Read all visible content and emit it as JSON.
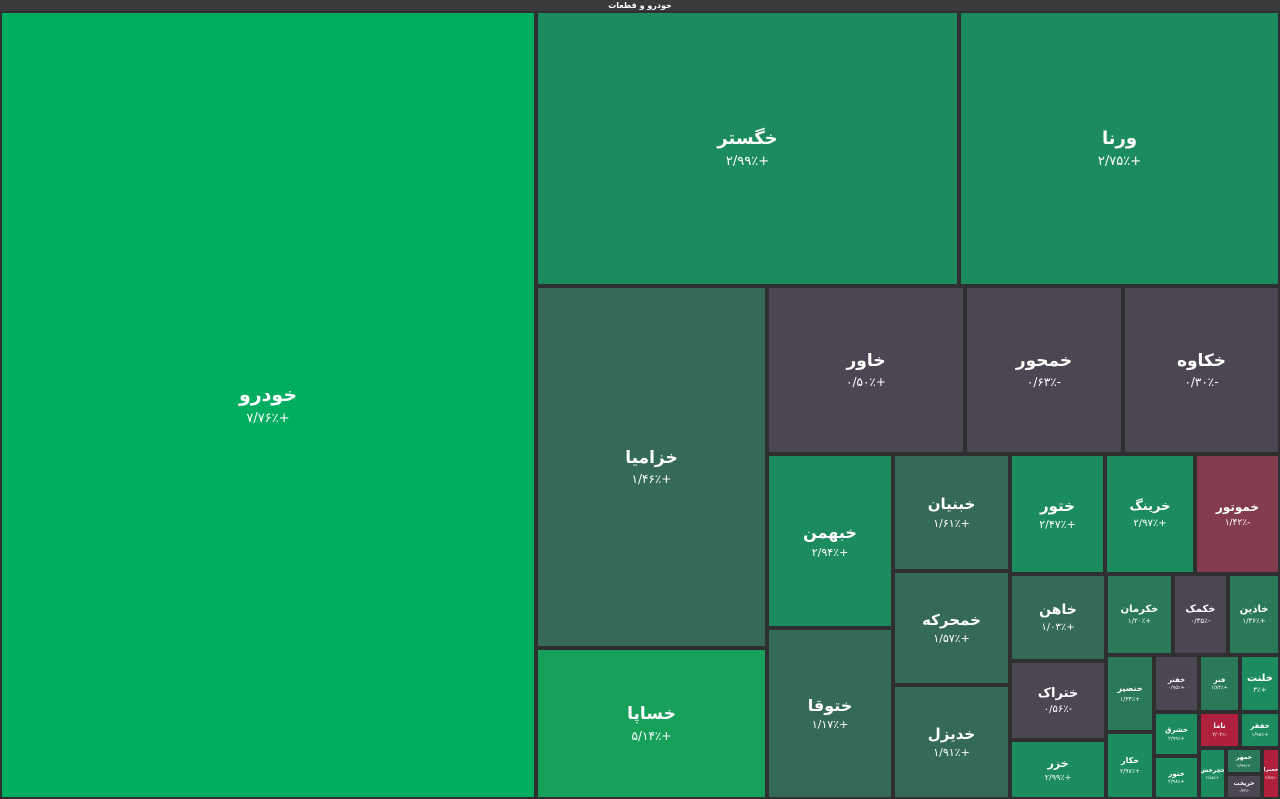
{
  "title": "خودرو و قطعات",
  "colors": {
    "up_strong": "#00ad61",
    "up_mid": "#17a05a",
    "up": "#1c8c5f",
    "up_soft": "#2a7a5a",
    "up_dim": "#356a57",
    "neutral": "#4c4653",
    "down": "#833c4e",
    "down_strong": "#b01f3c"
  },
  "chart_data": {
    "type": "treemap",
    "title": "خودرو و قطعات",
    "tiles": [
      {
        "symbol": "خودرو",
        "change": "+۷/۷۶٪",
        "value": 7.76
      },
      {
        "symbol": "خگستر",
        "change": "+۲/۹۹٪",
        "value": 2.99
      },
      {
        "symbol": "ورنا",
        "change": "+۲/۷۵٪",
        "value": 2.75
      },
      {
        "symbol": "خزامیا",
        "change": "+۱/۴۶٪",
        "value": 1.46
      },
      {
        "symbol": "خساپا",
        "change": "+۵/۱۴٪",
        "value": 5.14
      },
      {
        "symbol": "خاور",
        "change": "+۰/۵۰٪",
        "value": 0.5
      },
      {
        "symbol": "خمحور",
        "change": "-۰/۶۳٪",
        "value": -0.63
      },
      {
        "symbol": "خکاوه",
        "change": "-۰/۳۰٪",
        "value": -0.3
      },
      {
        "symbol": "خبهمن",
        "change": "+۲/۹۴٪",
        "value": 2.94
      },
      {
        "symbol": "خبنیان",
        "change": "+۱/۶۱٪",
        "value": 1.61
      },
      {
        "symbol": "ختور",
        "change": "+۲/۴۷٪",
        "value": 2.47
      },
      {
        "symbol": "خرینگ",
        "change": "+۲/۹۷٪",
        "value": 2.97
      },
      {
        "symbol": "خموتور",
        "change": "-۱/۴۲٪",
        "value": -1.42
      },
      {
        "symbol": "ختوقا",
        "change": "+۱/۱۷٪",
        "value": 1.17
      },
      {
        "symbol": "خمحرکه",
        "change": "+۱/۵۷٪",
        "value": 1.57
      },
      {
        "symbol": "خدیزل",
        "change": "+۱/۹۱٪",
        "value": 1.91
      },
      {
        "symbol": "خاهن",
        "change": "+۱/۰۳٪",
        "value": 1.03
      },
      {
        "symbol": "ختراک",
        "change": "-۰/۵۶٪",
        "value": -0.56
      },
      {
        "symbol": "خزر",
        "change": "+۲/۹۹٪",
        "value": 2.99
      },
      {
        "symbol": "خکرمان",
        "change": "+۱/۲۰٪",
        "value": 1.2
      },
      {
        "symbol": "خکمک",
        "change": "-۰/۳۵٪",
        "value": -0.35
      },
      {
        "symbol": "خاذین",
        "change": "+۱/۳۶٪",
        "value": 1.36
      },
      {
        "symbol": "خنصیر",
        "change": "+۱/۳۴٪",
        "value": 1.34
      },
      {
        "symbol": "خکار",
        "change": "+۲/۹۷٪",
        "value": 2.97
      },
      {
        "symbol": "خفنر",
        "change": "+۰/۹۵٪",
        "value": 0.95
      },
      {
        "symbol": "فنر",
        "change": "+۱/۸۴٪",
        "value": 1.84
      },
      {
        "symbol": "خلنت",
        "change": "+۳٪",
        "value": 3.0
      },
      {
        "symbol": "خشرق",
        "change": "+۲/۹۹٪",
        "value": 2.99
      },
      {
        "symbol": "ناما",
        "change": "-۲/۰۲٪",
        "value": -2.02
      },
      {
        "symbol": "خفقر",
        "change": "+۱/۹۸٪",
        "value": 1.98
      },
      {
        "symbol": "ختور",
        "change": "+۲/۹۸٪",
        "value": 2.98
      },
      {
        "symbol": "خچرخش",
        "change": "+۲/۸۵٪",
        "value": 2.85
      },
      {
        "symbol": "خمهر",
        "change": "+۲/۹۹٪",
        "value": 2.99
      },
      {
        "symbol": "خریخت",
        "change": "-۰/۳۳٪",
        "value": -0.33
      },
      {
        "symbol": "خعمرا",
        "change": "-۲/۸۷٪",
        "value": -2.87
      }
    ]
  }
}
